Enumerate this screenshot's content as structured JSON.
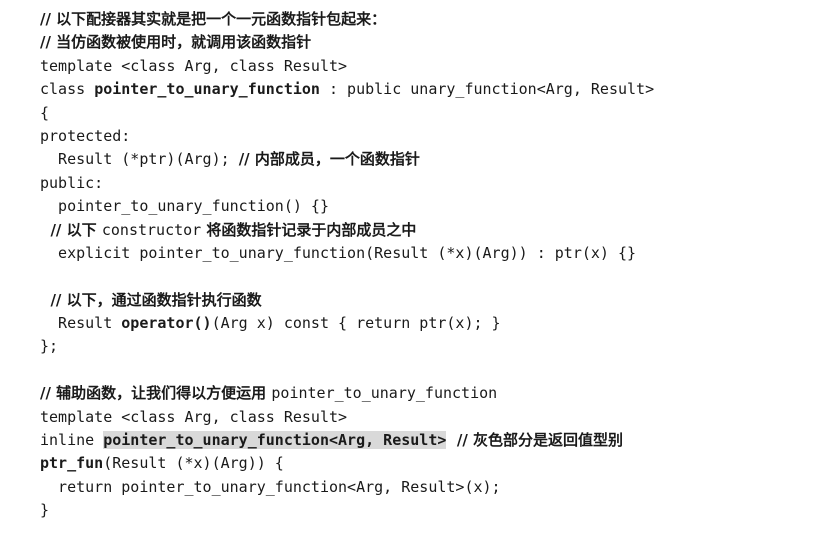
{
  "code": {
    "l1_comment": "// 以下配接器其实就是把一个一元函数指针包起来：",
    "l2_comment": "// 当仿函数被使用时，就调用该函数指针",
    "l3": "template <class Arg, class Result>",
    "l4_pre": "class ",
    "l4_name": "pointer_to_unary_function",
    "l4_post": " : public unary_function<Arg, Result>",
    "l5": "{",
    "l6": "protected:",
    "l7_code": "  Result (*ptr)(Arg); ",
    "l7_comment": "// 内部成员，一个函数指针",
    "l8": "public:",
    "l9": "  pointer_to_unary_function() {}",
    "l10_pre": "  // 以下 ",
    "l10_mid": "constructor",
    "l10_comment": " 将函数指针记录于内部成员之中",
    "l11": "  explicit pointer_to_unary_function(Result (*x)(Arg)) : ptr(x) {}",
    "l13_comment": "  // 以下，通过函数指针执行函数",
    "l14_pre": "  Result ",
    "l14_op": "operator()",
    "l14_post": "(Arg x) const { return ptr(x); }",
    "l15": "};",
    "l17_comment": "// 辅助函数，让我们得以方便运用 ",
    "l17_code": "pointer_to_unary_function",
    "l18": "template <class Arg, class Result>",
    "l19_pre": "inline ",
    "l19_hl": "pointer_to_unary_function<Arg, Result>",
    "l19_comment": "  // 灰色部分是返回值型别",
    "l20_name": "ptr_fun",
    "l20_post": "(Result (*x)(Arg)) {",
    "l21": "  return pointer_to_unary_function<Arg, Result>(x);",
    "l22": "}"
  },
  "colors": {
    "highlight": "#d9d9d9",
    "text": "#1a1a1a"
  }
}
